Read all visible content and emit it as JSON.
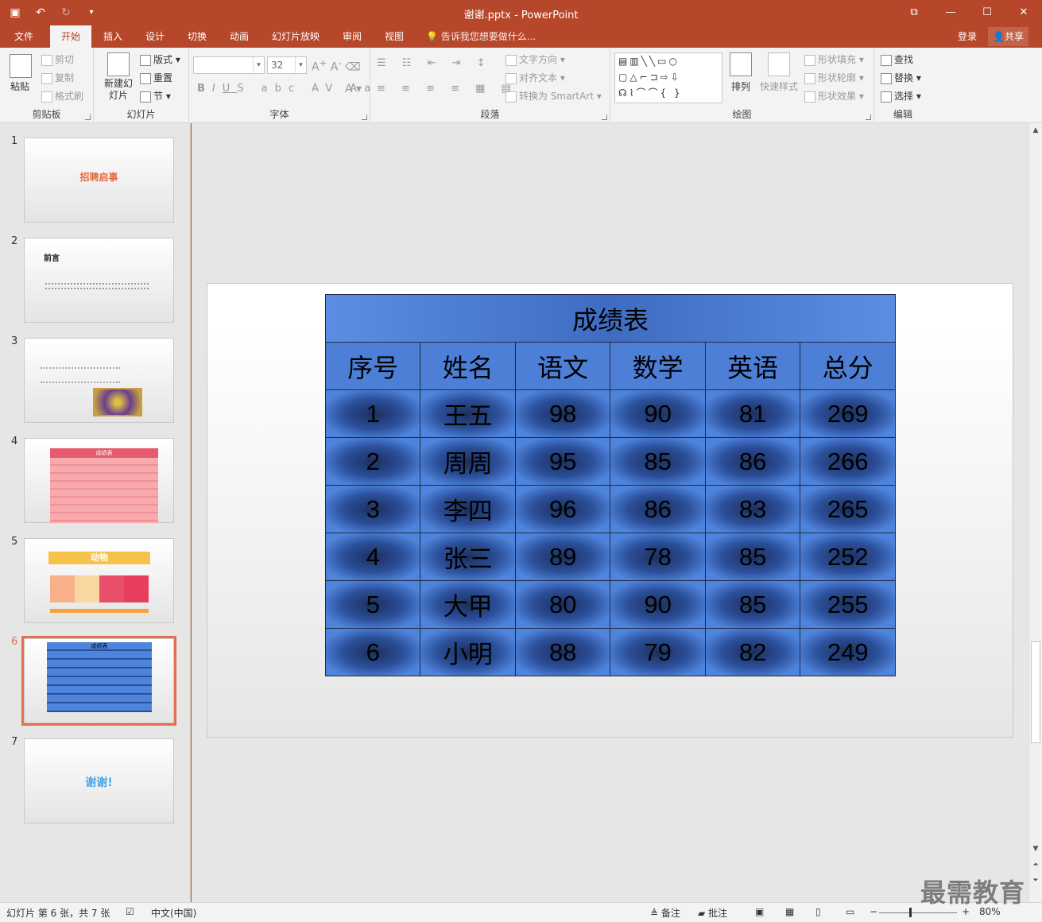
{
  "window": {
    "title": "谢谢.pptx - PowerPoint",
    "qat": [
      "save-icon",
      "undo-icon",
      "redo-icon",
      "customize-icon"
    ]
  },
  "tabs": [
    "文件",
    "开始",
    "插入",
    "设计",
    "切换",
    "动画",
    "幻灯片放映",
    "审阅",
    "视图"
  ],
  "active_tab": "开始",
  "tellme": "告诉我您想要做什么...",
  "account": {
    "login": "登录",
    "share": "共享"
  },
  "ribbon": {
    "clipboard": {
      "label": "剪贴板",
      "paste": "粘贴",
      "cut": "剪切",
      "copy": "复制",
      "format_painter": "格式刷"
    },
    "slides": {
      "label": "幻灯片",
      "new_slide": "新建幻灯片",
      "layout": "版式",
      "reset": "重置",
      "section": "节"
    },
    "font": {
      "label": "字体",
      "font_name": "",
      "font_size": "32"
    },
    "paragraph": {
      "label": "段落",
      "text_direction": "文字方向",
      "align_text": "对齐文本",
      "smartart": "转换为 SmartArt"
    },
    "drawing": {
      "label": "绘图",
      "arrange": "排列",
      "quick_styles": "快速样式",
      "fill": "形状填充",
      "outline": "形状轮廓",
      "effects": "形状效果"
    },
    "editing": {
      "label": "编辑",
      "find": "查找",
      "replace": "替换",
      "select": "选择"
    }
  },
  "thumbnails": [
    {
      "num": "1",
      "text": "招聘启事"
    },
    {
      "num": "2",
      "text": "前言"
    },
    {
      "num": "3",
      "text": ""
    },
    {
      "num": "4",
      "text": "成绩表"
    },
    {
      "num": "5",
      "text": "动物"
    },
    {
      "num": "6",
      "text": "成绩表"
    },
    {
      "num": "7",
      "text": "谢谢!"
    }
  ],
  "selected_slide": "6",
  "slide": {
    "table": {
      "title": "成绩表",
      "headers": [
        "序号",
        "姓名",
        "语文",
        "数学",
        "英语",
        "总分"
      ],
      "rows": [
        [
          "1",
          "王五",
          "98",
          "90",
          "81",
          "269"
        ],
        [
          "2",
          "周周",
          "95",
          "85",
          "86",
          "266"
        ],
        [
          "3",
          "李四",
          "96",
          "86",
          "83",
          "265"
        ],
        [
          "4",
          "张三",
          "89",
          "78",
          "85",
          "252"
        ],
        [
          "5",
          "大甲",
          "80",
          "90",
          "85",
          "255"
        ],
        [
          "6",
          "小明",
          "88",
          "79",
          "82",
          "249"
        ]
      ]
    }
  },
  "status": {
    "slide_info": "幻灯片 第 6 张，共 7 张",
    "language": "中文(中国)",
    "notes": "备注",
    "comments": "批注",
    "zoom": "80%"
  },
  "watermark": "最需教育",
  "colors": {
    "accent": "#b7472a",
    "table_fill": "#4d7fd6",
    "selection": "#e4704f"
  }
}
